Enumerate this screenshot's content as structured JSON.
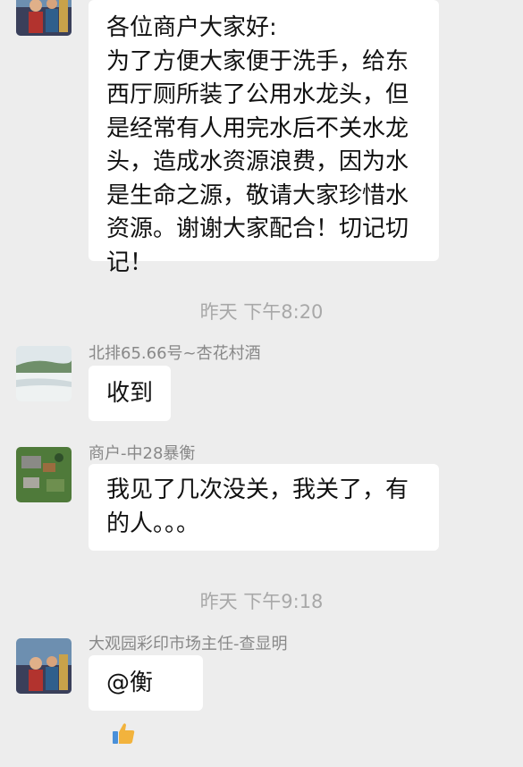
{
  "messages": [
    {
      "sender": "",
      "lines": [
        "各位商户大家好:",
        "为了方便大家便于洗手，给东",
        "西厅厕所装了公用水龙头，但",
        "是经常有人用完水后不关水龙",
        "头，造成水资源浪费，因为水",
        "是生命之源，敬请大家珍惜水",
        "资源。谢谢大家配合！切记切",
        "记！"
      ]
    },
    {
      "timestamp": "昨天 下午8:20"
    },
    {
      "sender": "北排65.66号~杏花村酒",
      "text": "收到"
    },
    {
      "sender": "商户-中28暴衡",
      "lines": [
        "我见了几次没关，我关了，有",
        "的人。。。"
      ]
    },
    {
      "timestamp": "昨天 下午9:18"
    },
    {
      "sender": "大观园彩印市场主任-查显明",
      "text": "@衡",
      "emoji": "thumbs-up"
    }
  ],
  "colors": {
    "background": "#ededed",
    "bubble": "#ffffff",
    "text": "#111111",
    "sender_name": "#888888",
    "timestamp": "#a8a8a8"
  }
}
